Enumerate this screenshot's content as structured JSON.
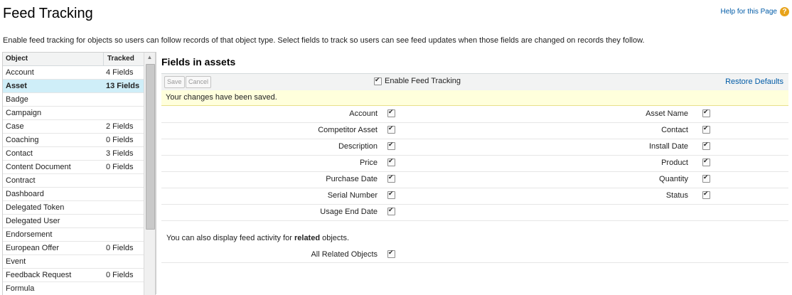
{
  "header": {
    "title": "Feed Tracking",
    "help_link": "Help for this Page",
    "help_icon": "?"
  },
  "description": "Enable feed tracking for objects so users can follow records of that object type. Select fields to track so users can see feed updates when those fields are changed on records they follow.",
  "object_list": {
    "col_object": "Object",
    "col_tracked": "Tracked",
    "selected": "Asset",
    "rows": [
      {
        "name": "Account",
        "tracked": "4 Fields"
      },
      {
        "name": "Asset",
        "tracked": "13 Fields"
      },
      {
        "name": "Badge",
        "tracked": ""
      },
      {
        "name": "Campaign",
        "tracked": ""
      },
      {
        "name": "Case",
        "tracked": "2 Fields"
      },
      {
        "name": "Coaching",
        "tracked": "0 Fields"
      },
      {
        "name": "Contact",
        "tracked": "3 Fields"
      },
      {
        "name": "Content Document",
        "tracked": "0 Fields"
      },
      {
        "name": "Contract",
        "tracked": ""
      },
      {
        "name": "Dashboard",
        "tracked": ""
      },
      {
        "name": "Delegated Token",
        "tracked": ""
      },
      {
        "name": "Delegated User",
        "tracked": ""
      },
      {
        "name": "Endorsement",
        "tracked": ""
      },
      {
        "name": "European Offer",
        "tracked": "0 Fields"
      },
      {
        "name": "Event",
        "tracked": ""
      },
      {
        "name": "Feedback Request",
        "tracked": "0 Fields"
      },
      {
        "name": "Formula",
        "tracked": ""
      }
    ]
  },
  "panel": {
    "title": "Fields in assets",
    "save_label": "Save",
    "cancel_label": "Cancel",
    "enable_label": "Enable Feed Tracking",
    "restore_label": "Restore Defaults",
    "saved_message": "Your changes have been saved.",
    "field_rows": [
      {
        "left": "Account",
        "right": "Asset Name"
      },
      {
        "left": "Competitor Asset",
        "right": "Contact"
      },
      {
        "left": "Description",
        "right": "Install Date"
      },
      {
        "left": "Price",
        "right": "Product"
      },
      {
        "left": "Purchase Date",
        "right": "Quantity"
      },
      {
        "left": "Serial Number",
        "right": "Status"
      },
      {
        "left": "Usage End Date",
        "right": ""
      }
    ],
    "related_prefix": "You can also display feed activity for ",
    "related_bold": "related",
    "related_suffix": " objects.",
    "all_related_label": "All Related Objects"
  }
}
